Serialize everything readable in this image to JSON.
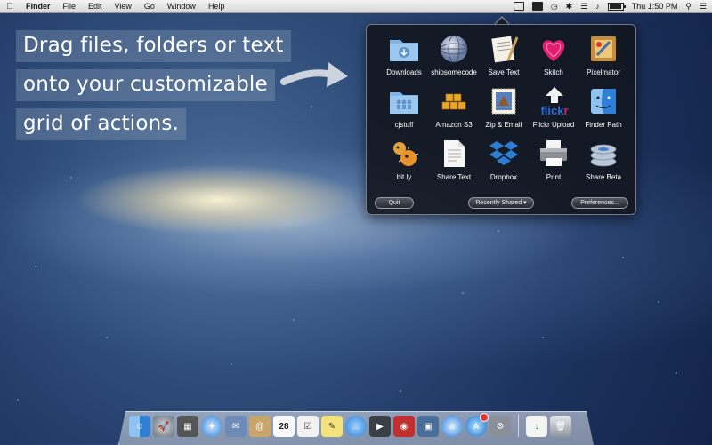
{
  "menubar": {
    "app_name": "Finder",
    "menus": [
      "File",
      "Edit",
      "View",
      "Go",
      "Window",
      "Help"
    ],
    "battery_percent": "",
    "clock": "Thu 1:50 PM"
  },
  "promo": {
    "lines": [
      "Drag files, folders or text",
      "onto your customizable",
      "grid of actions."
    ]
  },
  "panel": {
    "items": [
      {
        "label": "Downloads",
        "icon": "downloads-folder-icon"
      },
      {
        "label": "shipsomecode",
        "icon": "network-globe-icon"
      },
      {
        "label": "Save Text",
        "icon": "save-text-icon"
      },
      {
        "label": "Skitch",
        "icon": "skitch-heart-icon"
      },
      {
        "label": "Pixelmator",
        "icon": "pixelmator-icon"
      },
      {
        "label": "cjstuff",
        "icon": "shared-folder-icon"
      },
      {
        "label": "Amazon S3",
        "icon": "amazon-s3-cubes-icon"
      },
      {
        "label": "Zip & Email",
        "icon": "zip-email-stamp-icon"
      },
      {
        "label": "Flickr Upload",
        "icon": "flickr-upload-icon"
      },
      {
        "label": "Finder Path",
        "icon": "finder-face-icon"
      },
      {
        "label": "bit.ly",
        "icon": "bitly-blowfish-icon"
      },
      {
        "label": "Share Text",
        "icon": "text-document-icon"
      },
      {
        "label": "Dropbox",
        "icon": "dropbox-icon"
      },
      {
        "label": "Print",
        "icon": "printer-icon"
      },
      {
        "label": "Share Beta",
        "icon": "share-disks-icon"
      }
    ],
    "quit_label": "Quit",
    "recent_label": "Recently Shared",
    "prefs_label": "Preferences..."
  },
  "colors": {
    "panel_bg": "#12161e",
    "accent_blue": "#2f7fd6",
    "dropbox_blue": "#2a7fd4",
    "skitch_pink": "#e0206f"
  }
}
